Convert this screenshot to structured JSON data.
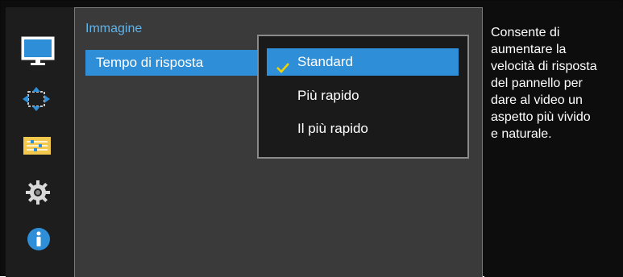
{
  "colors": {
    "accent_blue": "#2e8fd8",
    "title_blue": "#5fb3ea",
    "check_yellow": "#f2d400",
    "panel_gray": "#3a3a3a",
    "iconbar_gray": "#1d1d1d"
  },
  "sidebar": {
    "icons": [
      {
        "name": "picture-icon",
        "selected": true
      },
      {
        "name": "screen-adjust-icon",
        "selected": false
      },
      {
        "name": "onscreen-display-icon",
        "selected": false
      },
      {
        "name": "system-icon",
        "selected": false
      },
      {
        "name": "information-icon",
        "selected": false
      }
    ]
  },
  "main": {
    "title": "Immagine",
    "menu_item": "Tempo di risposta"
  },
  "dropdown": {
    "options": [
      {
        "label": "Standard",
        "selected": true
      },
      {
        "label": "Più rapido",
        "selected": false
      },
      {
        "label": "Il più rapido",
        "selected": false
      }
    ]
  },
  "description": {
    "text_lines": [
      "Consente di",
      "aumentare la",
      "velocità di risposta",
      "del pannello per",
      "dare al video un",
      "aspetto più vivido",
      "e naturale."
    ]
  }
}
